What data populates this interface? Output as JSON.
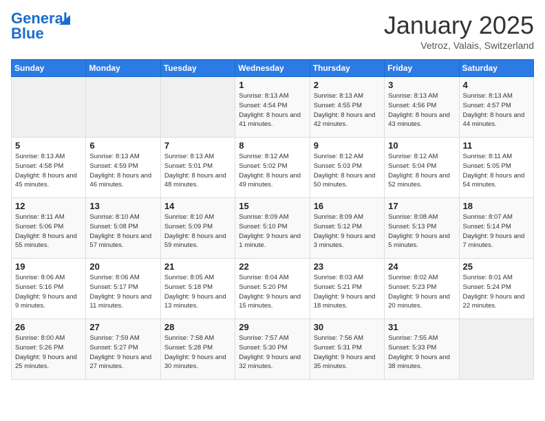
{
  "header": {
    "logo_line1": "General",
    "logo_line2": "Blue",
    "title": "January 2025",
    "subtitle": "Vetroz, Valais, Switzerland"
  },
  "weekdays": [
    "Sunday",
    "Monday",
    "Tuesday",
    "Wednesday",
    "Thursday",
    "Friday",
    "Saturday"
  ],
  "weeks": [
    [
      {
        "day": "",
        "info": ""
      },
      {
        "day": "",
        "info": ""
      },
      {
        "day": "",
        "info": ""
      },
      {
        "day": "1",
        "info": "Sunrise: 8:13 AM\nSunset: 4:54 PM\nDaylight: 8 hours and 41 minutes."
      },
      {
        "day": "2",
        "info": "Sunrise: 8:13 AM\nSunset: 4:55 PM\nDaylight: 8 hours and 42 minutes."
      },
      {
        "day": "3",
        "info": "Sunrise: 8:13 AM\nSunset: 4:56 PM\nDaylight: 8 hours and 43 minutes."
      },
      {
        "day": "4",
        "info": "Sunrise: 8:13 AM\nSunset: 4:57 PM\nDaylight: 8 hours and 44 minutes."
      }
    ],
    [
      {
        "day": "5",
        "info": "Sunrise: 8:13 AM\nSunset: 4:58 PM\nDaylight: 8 hours and 45 minutes."
      },
      {
        "day": "6",
        "info": "Sunrise: 8:13 AM\nSunset: 4:59 PM\nDaylight: 8 hours and 46 minutes."
      },
      {
        "day": "7",
        "info": "Sunrise: 8:13 AM\nSunset: 5:01 PM\nDaylight: 8 hours and 48 minutes."
      },
      {
        "day": "8",
        "info": "Sunrise: 8:12 AM\nSunset: 5:02 PM\nDaylight: 8 hours and 49 minutes."
      },
      {
        "day": "9",
        "info": "Sunrise: 8:12 AM\nSunset: 5:03 PM\nDaylight: 8 hours and 50 minutes."
      },
      {
        "day": "10",
        "info": "Sunrise: 8:12 AM\nSunset: 5:04 PM\nDaylight: 8 hours and 52 minutes."
      },
      {
        "day": "11",
        "info": "Sunrise: 8:11 AM\nSunset: 5:05 PM\nDaylight: 8 hours and 54 minutes."
      }
    ],
    [
      {
        "day": "12",
        "info": "Sunrise: 8:11 AM\nSunset: 5:06 PM\nDaylight: 8 hours and 55 minutes."
      },
      {
        "day": "13",
        "info": "Sunrise: 8:10 AM\nSunset: 5:08 PM\nDaylight: 8 hours and 57 minutes."
      },
      {
        "day": "14",
        "info": "Sunrise: 8:10 AM\nSunset: 5:09 PM\nDaylight: 8 hours and 59 minutes."
      },
      {
        "day": "15",
        "info": "Sunrise: 8:09 AM\nSunset: 5:10 PM\nDaylight: 9 hours and 1 minute."
      },
      {
        "day": "16",
        "info": "Sunrise: 8:09 AM\nSunset: 5:12 PM\nDaylight: 9 hours and 3 minutes."
      },
      {
        "day": "17",
        "info": "Sunrise: 8:08 AM\nSunset: 5:13 PM\nDaylight: 9 hours and 5 minutes."
      },
      {
        "day": "18",
        "info": "Sunrise: 8:07 AM\nSunset: 5:14 PM\nDaylight: 9 hours and 7 minutes."
      }
    ],
    [
      {
        "day": "19",
        "info": "Sunrise: 8:06 AM\nSunset: 5:16 PM\nDaylight: 9 hours and 9 minutes."
      },
      {
        "day": "20",
        "info": "Sunrise: 8:06 AM\nSunset: 5:17 PM\nDaylight: 9 hours and 11 minutes."
      },
      {
        "day": "21",
        "info": "Sunrise: 8:05 AM\nSunset: 5:18 PM\nDaylight: 9 hours and 13 minutes."
      },
      {
        "day": "22",
        "info": "Sunrise: 8:04 AM\nSunset: 5:20 PM\nDaylight: 9 hours and 15 minutes."
      },
      {
        "day": "23",
        "info": "Sunrise: 8:03 AM\nSunset: 5:21 PM\nDaylight: 9 hours and 18 minutes."
      },
      {
        "day": "24",
        "info": "Sunrise: 8:02 AM\nSunset: 5:23 PM\nDaylight: 9 hours and 20 minutes."
      },
      {
        "day": "25",
        "info": "Sunrise: 8:01 AM\nSunset: 5:24 PM\nDaylight: 9 hours and 22 minutes."
      }
    ],
    [
      {
        "day": "26",
        "info": "Sunrise: 8:00 AM\nSunset: 5:26 PM\nDaylight: 9 hours and 25 minutes."
      },
      {
        "day": "27",
        "info": "Sunrise: 7:59 AM\nSunset: 5:27 PM\nDaylight: 9 hours and 27 minutes."
      },
      {
        "day": "28",
        "info": "Sunrise: 7:58 AM\nSunset: 5:28 PM\nDaylight: 9 hours and 30 minutes."
      },
      {
        "day": "29",
        "info": "Sunrise: 7:57 AM\nSunset: 5:30 PM\nDaylight: 9 hours and 32 minutes."
      },
      {
        "day": "30",
        "info": "Sunrise: 7:56 AM\nSunset: 5:31 PM\nDaylight: 9 hours and 35 minutes."
      },
      {
        "day": "31",
        "info": "Sunrise: 7:55 AM\nSunset: 5:33 PM\nDaylight: 9 hours and 38 minutes."
      },
      {
        "day": "",
        "info": ""
      }
    ]
  ]
}
